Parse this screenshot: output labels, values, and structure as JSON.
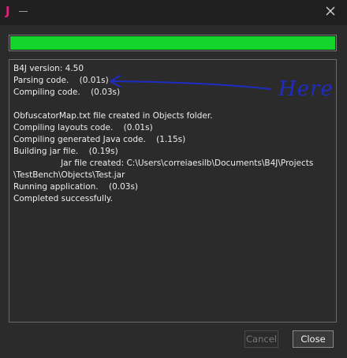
{
  "titlebar": {
    "app_icon_text": "J",
    "app_icon_color": "#e0217a"
  },
  "progress": {
    "fraction": 1.0,
    "fill_color": "#13d42a"
  },
  "log": {
    "lines": [
      "B4J version: 4.50",
      "Parsing code.    (0.01s)",
      "Compiling code.    (0.03s)",
      "",
      "ObfuscatorMap.txt file created in Objects folder.",
      "Compiling layouts code.    (0.01s)",
      "Compiling generated Java code.    (1.15s)",
      "Building jar file.    (0.19s)",
      "                  Jar file created: C:\\Users\\correiaesilb\\Documents\\B4J\\Projects",
      "\\TestBench\\Objects\\Test.jar",
      "Running application.    (0.03s)",
      "Completed successfully."
    ]
  },
  "annotation": {
    "label": "Here",
    "color": "#1f2cc4"
  },
  "buttons": {
    "cancel_label": "Cancel",
    "close_label": "Close"
  },
  "icons": {
    "close": "close-icon"
  }
}
